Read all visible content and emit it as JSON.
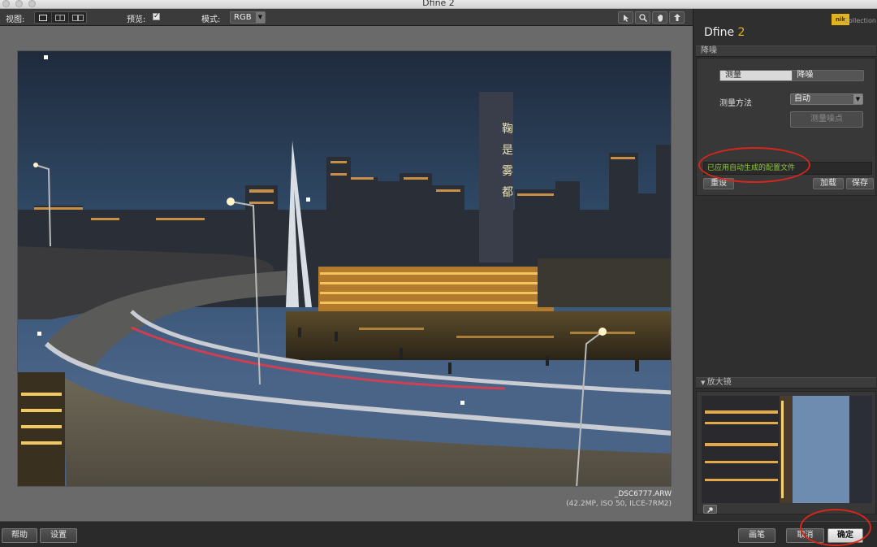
{
  "window": {
    "title": "Dfine 2"
  },
  "toolbar": {
    "view_label": "视图:",
    "preview_label": "预览:",
    "preview_checked": "✓",
    "mode_label": "模式:",
    "mode_value": "RGB"
  },
  "preview": {
    "filename": "_DSC6777.ARW",
    "file_details": "(42.2MP, ISO 50, ILCE-7RM2)",
    "tower_text": [
      "鞠",
      "是",
      "雾",
      "都"
    ]
  },
  "panel": {
    "logo_text": "nik",
    "logo_collection": "Collection",
    "app_name": "Dfine",
    "app_version": "2",
    "noise_section": "降噪",
    "tab_measure": "测量",
    "tab_reduce": "降噪",
    "method_label": "测量方法",
    "method_value": "自动",
    "measure_noise_button": "测量噪点",
    "status_text": "已应用自动生成的配置文件",
    "reset_button": "重设",
    "load_button": "加载",
    "save_button": "保存",
    "magnifier_section": "放大镜"
  },
  "bottombar": {
    "help_button": "帮助",
    "settings_button": "设置",
    "brush_button": "画笔",
    "cancel_button": "取消",
    "ok_button": "确定"
  },
  "colors": {
    "accent_version": "#e3b21c",
    "status_green": "#8cc83c",
    "annotation_red": "#d8261c",
    "logo_yellow": "#e1b41e"
  }
}
